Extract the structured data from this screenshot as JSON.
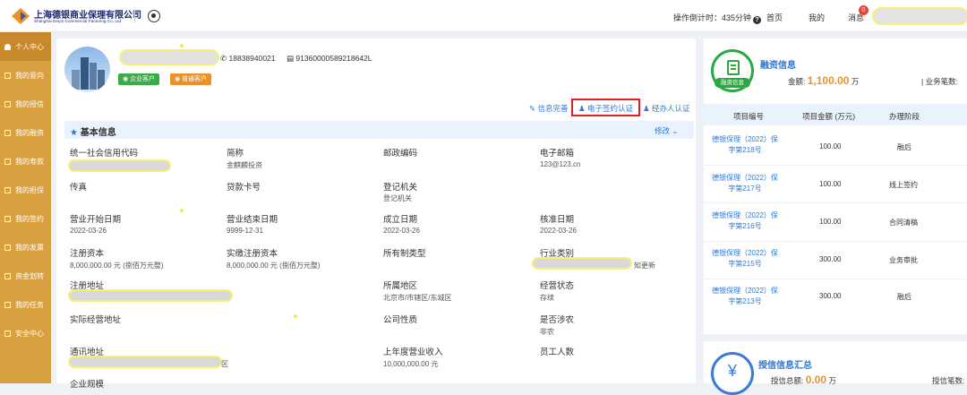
{
  "header": {
    "company_cn": "上海德银商业保理有限公司",
    "company_en": "Shanghai Deyin Commercial Factoring Co.,Ltd",
    "timer": "操作倒计时：435分钟",
    "nav": [
      "首页",
      "我的",
      "消息"
    ],
    "message_badge": "0"
  },
  "sidebar": {
    "items": [
      {
        "label": "个人中心",
        "active": true
      },
      {
        "label": "我的意向"
      },
      {
        "label": "我的授信"
      },
      {
        "label": "我的融资"
      },
      {
        "label": "我的寿款"
      },
      {
        "label": "我的担保"
      },
      {
        "label": "我的签约"
      },
      {
        "label": "我的发票"
      },
      {
        "label": "资金划转"
      },
      {
        "label": "我的任务"
      },
      {
        "label": "安全中心"
      }
    ]
  },
  "profile": {
    "phone": "18838940021",
    "credit_id": "91360000589218642L",
    "tags": [
      "企业客户",
      "普通客户"
    ],
    "actions": [
      "信息完善",
      "电子签约认证",
      "经办人认证"
    ]
  },
  "basic_info": {
    "title": "基本信息",
    "edit": "修改",
    "fields": [
      {
        "label": "统一社会信用代码",
        "value": ""
      },
      {
        "label": "简称",
        "value": "金麒麟投资"
      },
      {
        "label": "邮政编码",
        "value": ""
      },
      {
        "label": "电子邮箱",
        "value": "123@123.cn"
      },
      {
        "label": "传真",
        "value": ""
      },
      {
        "label": "贷款卡号",
        "value": ""
      },
      {
        "label": "登记机关",
        "value": "登记机关"
      },
      {
        "label": "营业开始日期",
        "value": "2022-03-26"
      },
      {
        "label": "营业结束日期",
        "value": "9999-12-31"
      },
      {
        "label": "成立日期",
        "value": "2022-03-26"
      },
      {
        "label": "核准日期",
        "value": "2022-03-26"
      },
      {
        "label": "注册资本",
        "value": "8,000,000.00 元 (捌佰万元整)"
      },
      {
        "label": "实缴注册资本",
        "value": "8,000,000.00 元 (捌佰万元整)"
      },
      {
        "label": "所有制类型",
        "value": ""
      },
      {
        "label": "行业类别",
        "value": "知更新"
      },
      {
        "label": "注册地址",
        "value": ""
      },
      {
        "label": "所属地区",
        "value": "北京市/市辖区/东城区"
      },
      {
        "label": "经营状态",
        "value": "存续"
      },
      {
        "label": "实际经营地址",
        "value": ""
      },
      {
        "label": "公司性质",
        "value": ""
      },
      {
        "label": "是否涉农",
        "value": "非农"
      },
      {
        "label": "通讯地址",
        "value": "区"
      },
      {
        "label": "上年度营业收入",
        "value": "10,000,000.00 元"
      },
      {
        "label": "员工人数",
        "value": ""
      },
      {
        "label": "企业规模",
        "value": ""
      }
    ]
  },
  "finance": {
    "badge": "融资信息",
    "title": "融资信息",
    "amount_label": "金额:",
    "amount": "1,100.00",
    "amount_unit": "万",
    "count_label": "| 业务笔数:",
    "columns": [
      "项目编号",
      "项目金额 (万元)",
      "办理阶段"
    ],
    "rows": [
      {
        "id_line1": "德银保理（2022）保",
        "id_line2": "字第218号",
        "amount": "100.00",
        "stage": "融后"
      },
      {
        "id_line1": "德银保理（2022）保",
        "id_line2": "字第217号",
        "amount": "100.00",
        "stage": "线上签约"
      },
      {
        "id_line1": "德银保理（2022）保",
        "id_line2": "字第216号",
        "amount": "100.00",
        "stage": "合同清稿"
      },
      {
        "id_line1": "德银保理（2022）保",
        "id_line2": "字第215号",
        "amount": "300.00",
        "stage": "业务审批"
      },
      {
        "id_line1": "德银保理（2022）保",
        "id_line2": "字第213号",
        "amount": "300.00",
        "stage": "融后"
      }
    ]
  },
  "credit": {
    "title": "授信信息汇总",
    "icon": "¥",
    "total_label": "授信总额:",
    "total": "0.00",
    "total_unit": "万",
    "count_label": "授信笔数:"
  }
}
